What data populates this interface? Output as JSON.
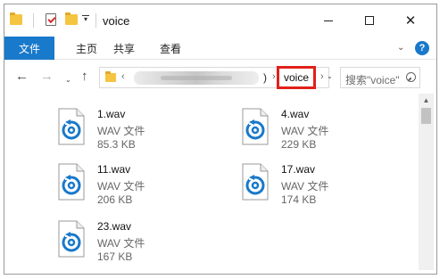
{
  "window": {
    "title": "voice",
    "quick_access": {
      "dropdown_glyph": "▾"
    },
    "controls": {
      "close_glyph": "✕"
    }
  },
  "ribbon": {
    "file_tab": "文件",
    "tabs": [
      "主页",
      "共享",
      "查看"
    ],
    "expand_glyph": "⌄",
    "help_glyph": "?"
  },
  "address": {
    "back_glyph": "←",
    "forward_glyph": "→",
    "recent_glyph": "⌄",
    "up_glyph": "↑",
    "chevron": "‹",
    "separator": "›",
    "path_tail": ")",
    "current_folder": "voice",
    "dropdown_glyph": "⌄",
    "search_placeholder": "搜索\"voice\""
  },
  "files": [
    {
      "name": "1.wav",
      "type": "WAV 文件",
      "size": "85.3 KB"
    },
    {
      "name": "4.wav",
      "type": "WAV 文件",
      "size": "229 KB"
    },
    {
      "name": "11.wav",
      "type": "WAV 文件",
      "size": "206 KB"
    },
    {
      "name": "17.wav",
      "type": "WAV 文件",
      "size": "174 KB"
    },
    {
      "name": "23.wav",
      "type": "WAV 文件",
      "size": "167 KB"
    }
  ],
  "icons": {
    "file": "wav-audio-file-icon",
    "accent": "#1979ca",
    "highlight": "#e0201b"
  },
  "scrollbar": {
    "up_glyph": "▲"
  }
}
